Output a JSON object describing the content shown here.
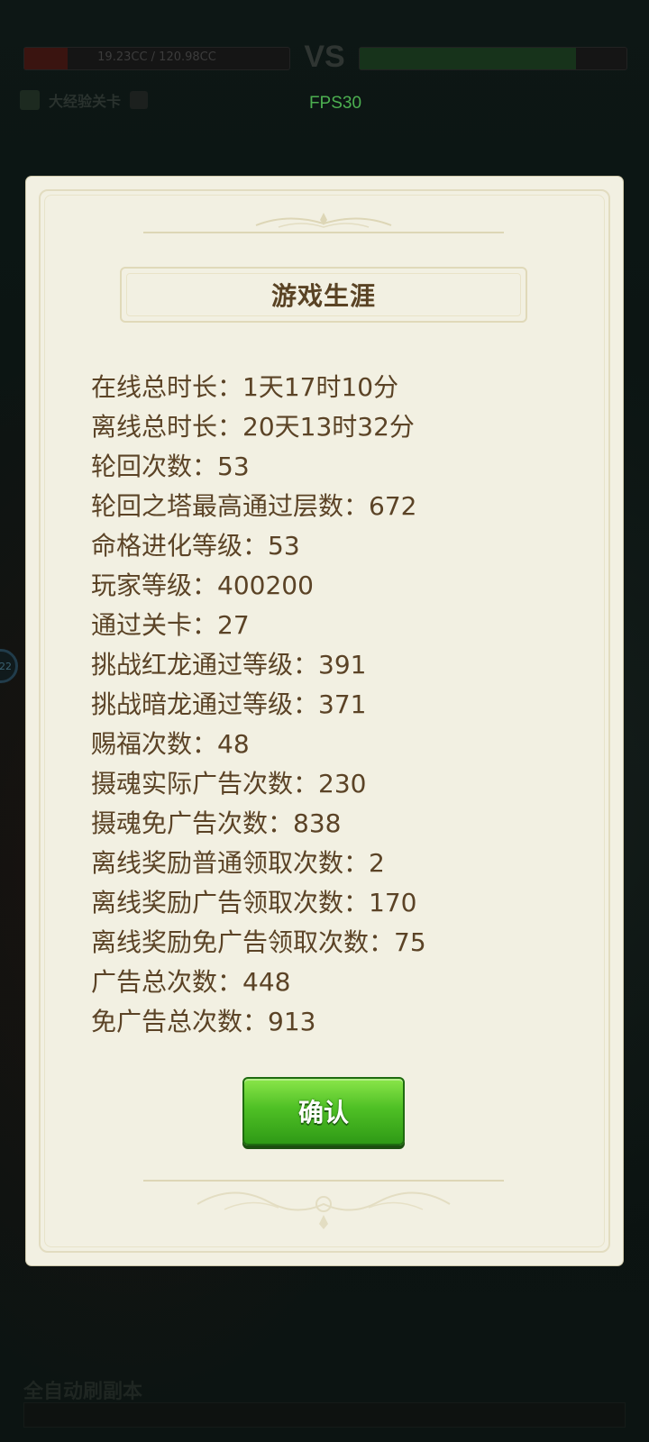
{
  "hud": {
    "left_hp": "19.23CC / 120.98CC",
    "vs": "VS",
    "right_hp": "—",
    "stage_label": "大经验关卡",
    "fps": "FPS30",
    "side_badge": "22",
    "bottom_text": "全自动刷副本",
    "bottom_bar_text": "—"
  },
  "dialog": {
    "title": "游戏生涯",
    "stats": [
      "在线总时长：1天17时10分",
      "离线总时长：20天13时32分",
      "轮回次数：53",
      "轮回之塔最高通过层数：672",
      "命格进化等级：53",
      "玩家等级：400200",
      "通过关卡：27",
      "挑战红龙通过等级：391",
      "挑战暗龙通过等级：371",
      "赐福次数：48",
      "摄魂实际广告次数：230",
      "摄魂免广告次数：838",
      "离线奖励普通领取次数：2",
      "离线奖励广告领取次数：170",
      "离线奖励免广告领取次数：75",
      "广告总次数：448",
      "免广告总次数：913"
    ],
    "confirm_label": "确认"
  },
  "colors": {
    "dialog_bg": "#f2f0e2",
    "text_brown": "#5b4326",
    "button_green": "#4fc025",
    "fps_green": "#4caf50"
  }
}
